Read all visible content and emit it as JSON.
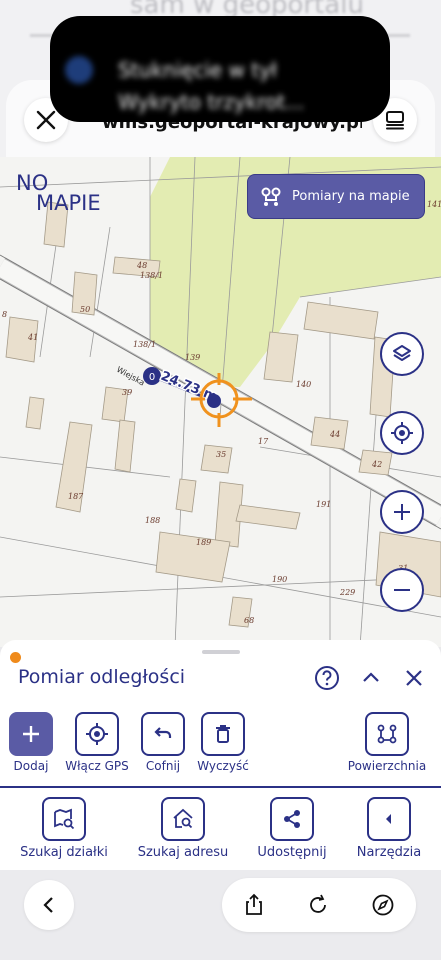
{
  "background": {
    "blurred_heading": "sam w geoportalu",
    "notification_line1": "Stuknięcie w tył",
    "notification_line2": "Wykryto trzykrot..."
  },
  "browser": {
    "url": "wms.geoportal-krajowy.pl",
    "close_icon": "close-icon",
    "reader_icon": "reader-mode-icon"
  },
  "map": {
    "logo_line1": "NO",
    "logo_line2": "MAPIE",
    "measure_button": "Pomiary na mapie",
    "measurement_label": "24.73 m",
    "point_label": "0",
    "street_label": "Wiejska",
    "parcel_labels": [
      "48",
      "138/1",
      "50",
      "41",
      "138/1",
      "139",
      "140",
      "39",
      "17",
      "44",
      "42",
      "35",
      "187",
      "191",
      "188",
      "189",
      "190",
      "31",
      "229",
      "68",
      "141",
      "8"
    ],
    "colors": {
      "field": "#e3ecb2",
      "building": "#e9dfcd",
      "brand": "#2b3186",
      "crosshair": "#f0921e"
    }
  },
  "sheet": {
    "title": "Pomiar odległości",
    "tools": [
      {
        "label": "Dodaj",
        "icon": "plus-icon"
      },
      {
        "label": "Włącz GPS",
        "icon": "gps-icon"
      },
      {
        "label": "Cofnij",
        "icon": "undo-icon"
      },
      {
        "label": "Wyczyść",
        "icon": "trash-icon"
      },
      {
        "label": "Powierzchnia",
        "icon": "polygon-icon"
      }
    ]
  },
  "nav": {
    "items": [
      {
        "label": "Szukaj działki",
        "icon": "parcel-search-icon"
      },
      {
        "label": "Szukaj adresu",
        "icon": "address-search-icon"
      },
      {
        "label": "Udostępnij",
        "icon": "share-icon"
      },
      {
        "label": "Narzędzia",
        "icon": "tools-icon"
      }
    ]
  }
}
